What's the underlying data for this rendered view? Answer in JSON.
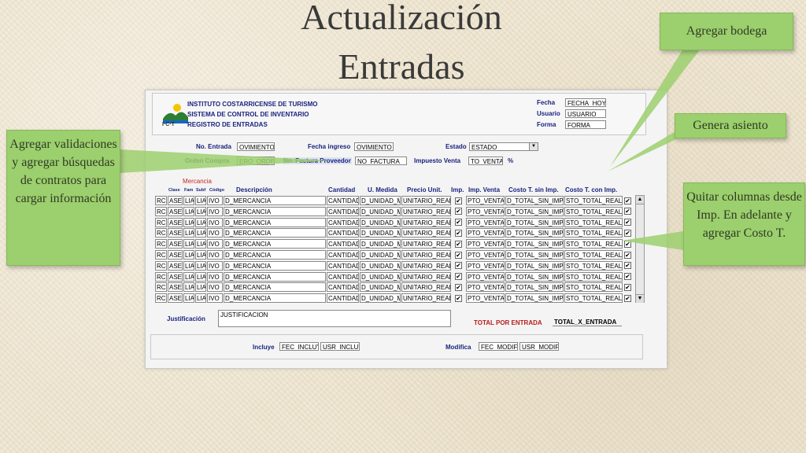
{
  "slide": {
    "title_line1": "Actualización",
    "title_line2": "Entradas"
  },
  "notes": {
    "bodega": "Agregar bodega",
    "asiento": "Genera asiento",
    "quitar": "Quitar columnas desde Imp. En adelante y agregar Costo T.",
    "validar": "Agregar validaciones y agregar búsquedas de contratos para cargar información"
  },
  "header": {
    "org": "INSTITUTO COSTARRICENSE DE TURISMO",
    "system": "SISTEMA DE CONTROL DE INVENTARIO",
    "screen": "REGISTRO DE ENTRADAS",
    "fecha_label": "Fecha",
    "fecha_value": "FECHA_HOY",
    "usuario_label": "Usuario",
    "usuario_value": "USUARIO",
    "forma_label": "Forma",
    "forma_value": "FORMA",
    "logo_text": "I·C·T"
  },
  "form": {
    "no_entrada_label": "No. Entrada",
    "no_entrada_value": "OVIMIENTO",
    "fecha_ingreso_label": "Fecha ingreso",
    "fecha_ingreso_value": "OVIMIENTO",
    "estado_label": "Estado",
    "estado_value": "ESTADO",
    "orden_compra_label": "Orden Compra",
    "orden_compra_value": "ERO_ORDEN",
    "factura_label": "No. Factura Proveedor",
    "factura_value": "NO_FACTURA",
    "impuesto_label": "Impuesto Venta",
    "impuesto_value": "TO_VENTA",
    "impuesto_unit": "%"
  },
  "grid": {
    "group_label": "Mercancia",
    "columns": {
      "clase": "Clase",
      "fam": "Fam",
      "subf": "Subf",
      "codigo": "Código",
      "descripcion": "Descripción",
      "cantidad": "Cantidad",
      "medida": "U. Medida",
      "precio": "Precio Unit.",
      "imp": "Imp.",
      "imp_venta": "Imp. Venta",
      "costo_sin": "Costo T. sin Imp.",
      "costo_con": "Costo T. con Imp."
    },
    "rows": [
      {
        "c": "RC",
        "f": "ASE",
        "s": "LIA",
        "sb": "LIA",
        "cod": "IVO",
        "d": "D_MERCANCIA",
        "q": "CANTIDAD",
        "u": "D_UNIDAD_MI",
        "p": "UNITARIO_REAL",
        "iv": "PTO_VENTA",
        "cs": "D_TOTAL_SIN_IMP",
        "cc": "STO_TOTAL_REAL"
      },
      {
        "c": "RC",
        "f": "ASE",
        "s": "LIA",
        "sb": "LIA",
        "cod": "IVO",
        "d": "D_MERCANCIA",
        "q": "CANTIDAD",
        "u": "D_UNIDAD_MI",
        "p": "UNITARIO_REAL",
        "iv": "PTO_VENTA",
        "cs": "D_TOTAL_SIN_IMP",
        "cc": "STO_TOTAL_REAL"
      },
      {
        "c": "RC",
        "f": "ASE",
        "s": "LIA",
        "sb": "LIA",
        "cod": "IVO",
        "d": "D_MERCANCIA",
        "q": "CANTIDAD",
        "u": "D_UNIDAD_MI",
        "p": "UNITARIO_REAL",
        "iv": "PTO_VENTA",
        "cs": "D_TOTAL_SIN_IMP",
        "cc": "STO_TOTAL_REAL"
      },
      {
        "c": "RC",
        "f": "ASE",
        "s": "LIA",
        "sb": "LIA",
        "cod": "IVO",
        "d": "D_MERCANCIA",
        "q": "CANTIDAD",
        "u": "D_UNIDAD_MI",
        "p": "UNITARIO_REAL",
        "iv": "PTO_VENTA",
        "cs": "D_TOTAL_SIN_IMP",
        "cc": "STO_TOTAL_REAL"
      },
      {
        "c": "RC",
        "f": "ASE",
        "s": "LIA",
        "sb": "LIA",
        "cod": "IVO",
        "d": "D_MERCANCIA",
        "q": "CANTIDAD",
        "u": "D_UNIDAD_MI",
        "p": "UNITARIO_REAL",
        "iv": "PTO_VENTA",
        "cs": "D_TOTAL_SIN_IMP",
        "cc": "STO_TOTAL_REAL"
      },
      {
        "c": "RC",
        "f": "ASE",
        "s": "LIA",
        "sb": "LIA",
        "cod": "IVO",
        "d": "D_MERCANCIA",
        "q": "CANTIDAD",
        "u": "D_UNIDAD_MI",
        "p": "UNITARIO_REAL",
        "iv": "PTO_VENTA",
        "cs": "D_TOTAL_SIN_IMP",
        "cc": "STO_TOTAL_REAL"
      },
      {
        "c": "RC",
        "f": "ASE",
        "s": "LIA",
        "sb": "LIA",
        "cod": "IVO",
        "d": "D_MERCANCIA",
        "q": "CANTIDAD",
        "u": "D_UNIDAD_MI",
        "p": "UNITARIO_REAL",
        "iv": "PTO_VENTA",
        "cs": "D_TOTAL_SIN_IMP",
        "cc": "STO_TOTAL_REAL"
      },
      {
        "c": "RC",
        "f": "ASE",
        "s": "LIA",
        "sb": "LIA",
        "cod": "IVO",
        "d": "D_MERCANCIA",
        "q": "CANTIDAD",
        "u": "D_UNIDAD_MI",
        "p": "UNITARIO_REAL",
        "iv": "PTO_VENTA",
        "cs": "D_TOTAL_SIN_IMP",
        "cc": "STO_TOTAL_REAL"
      },
      {
        "c": "RC",
        "f": "ASE",
        "s": "LIA",
        "sb": "LIA",
        "cod": "IVO",
        "d": "D_MERCANCIA",
        "q": "CANTIDAD",
        "u": "D_UNIDAD_MI",
        "p": "UNITARIO_REAL",
        "iv": "PTO_VENTA",
        "cs": "D_TOTAL_SIN_IMP",
        "cc": "STO_TOTAL_REAL"
      },
      {
        "c": "RC",
        "f": "ASE",
        "s": "LIA",
        "sb": "LIA",
        "cod": "IVO",
        "d": "D_MERCANCIA",
        "q": "CANTIDAD",
        "u": "D_UNIDAD_MI",
        "p": "UNITARIO_REAL",
        "iv": "PTO_VENTA",
        "cs": "D_TOTAL_SIN_IMP",
        "cc": "STO_TOTAL_REAL"
      }
    ],
    "check_mark": "✔"
  },
  "footer": {
    "justificacion_label": "Justificación",
    "justificacion_value": "JUSTIFICACION",
    "total_label": "TOTAL POR ENTRADA",
    "total_value": "TOTAL_X_ENTRADA",
    "incluye_label": "Incluye",
    "fec_incluye": "FEC_INCLUY",
    "usr_incluye": "USR_INCLUYI",
    "modifica_label": "Modifica",
    "fec_modifica": "FEC_MODIFI",
    "usr_modifica": "USR_MODIFIC"
  },
  "colors": {
    "note_green": "#9ccf6d",
    "label_blue": "#1a237e",
    "total_red": "#b71c1c",
    "mercancia_red": "#c62828"
  }
}
